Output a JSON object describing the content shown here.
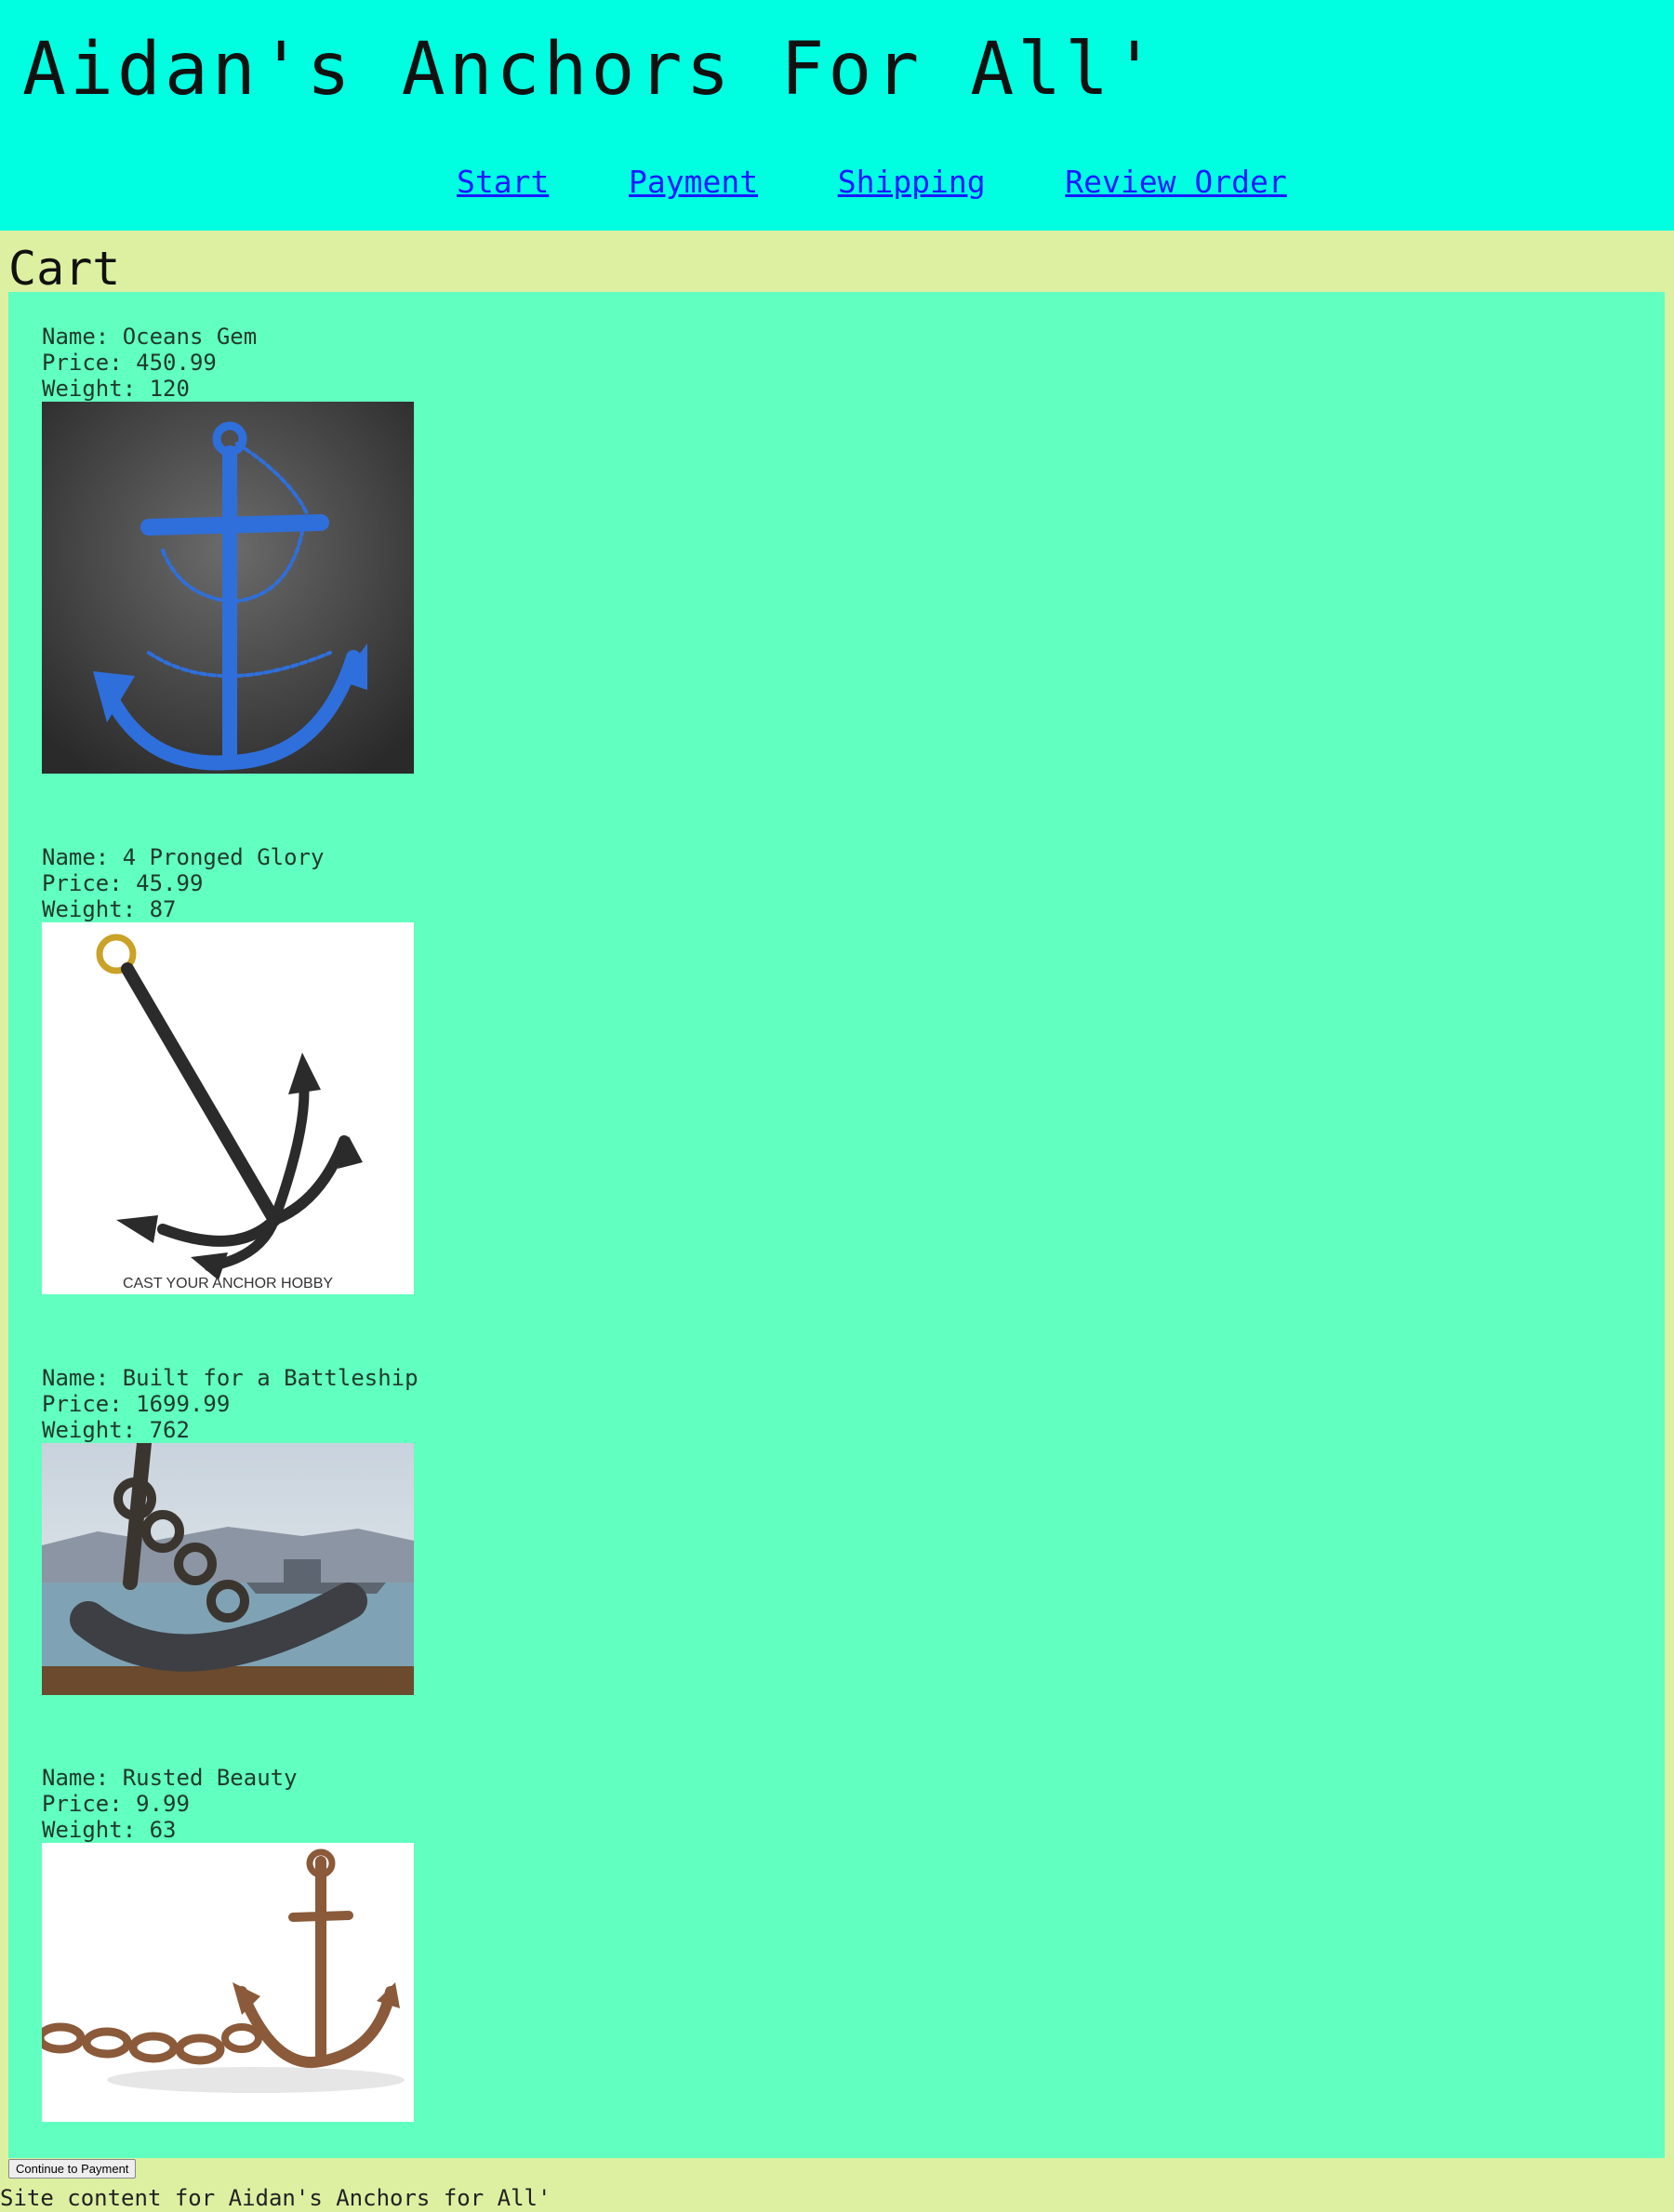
{
  "header": {
    "title": "Aidan's Anchors For All'",
    "nav": [
      "Start",
      "Payment",
      "Shipping",
      "Review Order"
    ]
  },
  "cart": {
    "heading": "Cart",
    "items": [
      {
        "name": "Name: Oceans Gem",
        "price": "Price: 450.99",
        "weight": "Weight: 120"
      },
      {
        "name": "Name: 4 Pronged Glory",
        "price": "Price: 45.99",
        "weight": "Weight: 87",
        "image_caption": "CAST YOUR ANCHOR HOBBY"
      },
      {
        "name": "Name: Built for a Battleship",
        "price": "Price: 1699.99",
        "weight": "Weight: 762"
      },
      {
        "name": "Name: Rusted Beauty",
        "price": "Price: 9.99",
        "weight": "Weight: 63"
      }
    ]
  },
  "continue_button": "Continue to Payment",
  "footer": "Site content for Aidan's Anchors for All'",
  "colors": {
    "header_bg": "#00ffe1",
    "page_bg": "#ddf0a1",
    "cart_bg": "#61ffc0",
    "link": "#1a1aff"
  }
}
